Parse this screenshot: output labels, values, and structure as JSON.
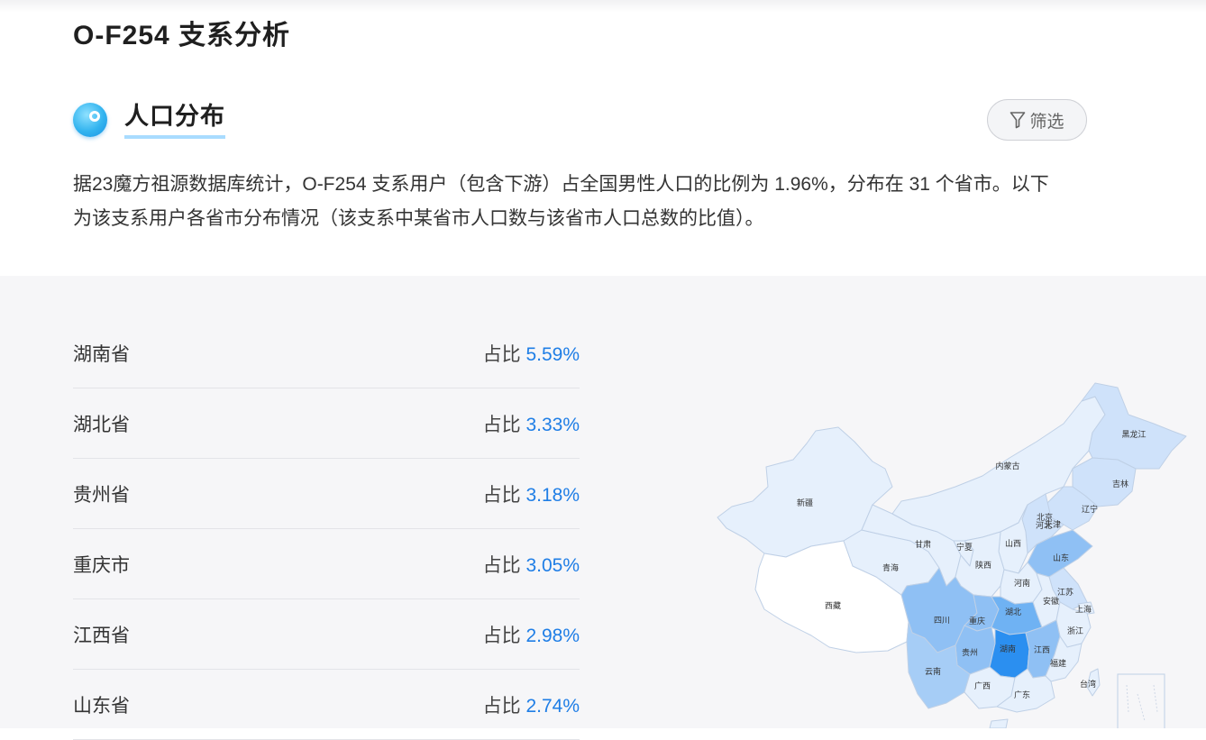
{
  "page": {
    "title": "O-F254 支系分析"
  },
  "section": {
    "title": "人口分布",
    "filter_label": "筛选",
    "description": "据23魔方祖源数据库统计，O-F254 支系用户（包含下游）占全国男性人口的比例为 1.96%，分布在 31 个省市。以下为该支系用户各省市分布情况（该支系中某省市人口数与该省市人口总数的比值）。"
  },
  "ratio_prefix": "占比",
  "provinces": [
    {
      "name": "湖南省",
      "value": "5.59%"
    },
    {
      "name": "湖北省",
      "value": "3.33%"
    },
    {
      "name": "贵州省",
      "value": "3.18%"
    },
    {
      "name": "重庆市",
      "value": "3.05%"
    },
    {
      "name": "江西省",
      "value": "2.98%"
    },
    {
      "name": "山东省",
      "value": "2.74%"
    }
  ],
  "map": {
    "labels": [
      "黑龙江",
      "吉林",
      "辽宁",
      "内蒙古",
      "北京",
      "天津",
      "河北",
      "新疆",
      "甘肃",
      "宁夏",
      "山西",
      "山东",
      "青海",
      "陕西",
      "河南",
      "江苏",
      "安徽",
      "上海",
      "西藏",
      "四川",
      "重庆",
      "湖北",
      "浙江",
      "湖南",
      "江西",
      "贵州",
      "福建",
      "云南",
      "广西",
      "广东",
      "台湾"
    ],
    "colors": {
      "darkest": "#2b8ff0",
      "dark": "#6fb2f3",
      "mid": "#a6cdf6",
      "light": "#cfe2fa",
      "lighter": "#e6f0fc",
      "white": "#ffffff",
      "stroke": "#bfd0e6"
    }
  }
}
